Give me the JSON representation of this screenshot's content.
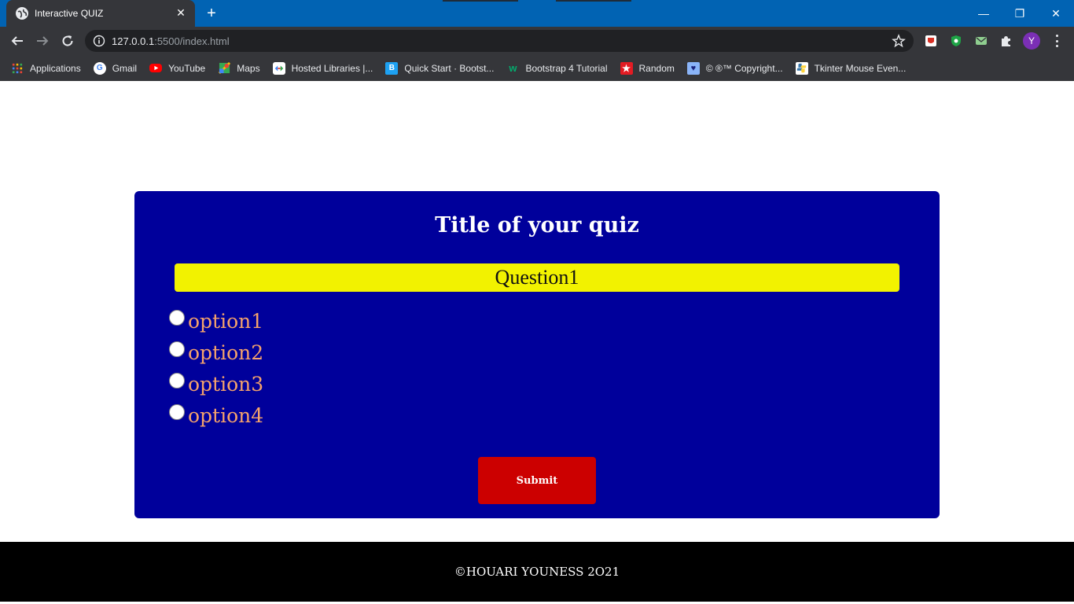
{
  "browser": {
    "tab_title": "Interactive QUIZ",
    "tab_close": "✕",
    "new_tab": "+",
    "window_controls": [
      "—",
      "❐",
      "✕"
    ],
    "url_host": "127.0.0.1",
    "url_rest": ":5500/index.html",
    "profile_initial": "Y",
    "bookmarks": [
      {
        "label": "Applications",
        "icon": "apps-grid-icon",
        "color": "#f4b400"
      },
      {
        "label": "Gmail",
        "icon": "google-icon",
        "color": "#ffffff"
      },
      {
        "label": "YouTube",
        "icon": "youtube-icon",
        "color": "#ff0000"
      },
      {
        "label": "Maps",
        "icon": "maps-icon",
        "color": "#34a853"
      },
      {
        "label": "Hosted Libraries  |...",
        "icon": "dev-icon",
        "color": "#ffffff"
      },
      {
        "label": "Quick Start · Bootst...",
        "icon": "bootstrap-icon",
        "color": "#1da1f2"
      },
      {
        "label": "Bootstrap 4 Tutorial",
        "icon": "w3-icon",
        "color": "#04aa6d"
      },
      {
        "label": "Random",
        "icon": "star-icon",
        "color": "#e31b23"
      },
      {
        "label": "© ®™ Copyright...",
        "icon": "heart-icon",
        "color": "#8ab4f8"
      },
      {
        "label": "Tkinter Mouse Even...",
        "icon": "python-icon",
        "color": "#ffffff"
      }
    ]
  },
  "quiz": {
    "title": "Title of your quiz",
    "question": "Question1",
    "options": [
      "option1",
      "option2",
      "option3",
      "option4"
    ],
    "submit_label": "Submit"
  },
  "footer": {
    "text": "©HOUARI YOUNESS 2O21"
  },
  "colors": {
    "titlebar": "#0163b3",
    "card": "#00009b",
    "question_bar": "#f2f200",
    "option_text": "#f5a36b",
    "submit": "#cc0000",
    "footer": "#000000"
  }
}
